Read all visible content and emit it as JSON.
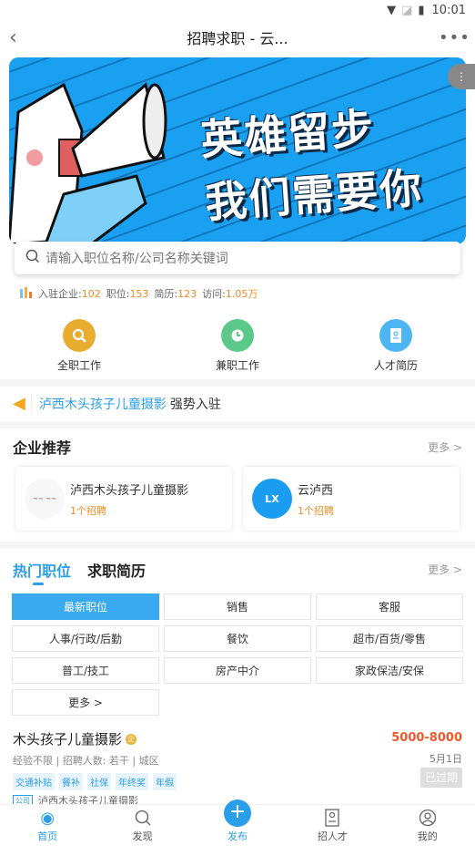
{
  "status_bar": {
    "time": "10:01"
  },
  "nav": {
    "title": "招聘求职 - 云...",
    "back_icon": "‹",
    "more_icon": "•••"
  },
  "banner": {
    "line1": "英雄留步",
    "line2": "我们需要你"
  },
  "search": {
    "placeholder": "请输入职位名称/公司名称关键词"
  },
  "stats": [
    {
      "label": "入驻企业:",
      "value": "102"
    },
    {
      "label": "职位:",
      "value": "153"
    },
    {
      "label": "简历:",
      "value": "123"
    },
    {
      "label": "访问:",
      "value": "1.05万"
    }
  ],
  "quick_entries": [
    {
      "label": "全职工作",
      "icon": "search-icon",
      "color": "#e8ad2e"
    },
    {
      "label": "兼职工作",
      "icon": "clock-icon",
      "color": "#5cc98a"
    },
    {
      "label": "人才简历",
      "icon": "resume-icon",
      "color": "#4cb6f5"
    }
  ],
  "notice": {
    "company": "泸西木头孩子儿童摄影",
    "text": "强势入驻"
  },
  "companies": {
    "title": "企业推荐",
    "more": "更多 >",
    "items": [
      {
        "name": "泸西木头孩子儿童摄影",
        "count": "1个招聘"
      },
      {
        "name": "云泸西",
        "count": "1个招聘",
        "logo_text": "LX"
      }
    ]
  },
  "jobs_section": {
    "tabs": [
      "热门职位",
      "求职简历"
    ],
    "active_tab": 0,
    "more": "更多 >",
    "categories": [
      "最新职位",
      "销售",
      "客服",
      "人事/行政/后勤",
      "餐饮",
      "超市/百货/零售",
      "普工/技工",
      "房产中介",
      "家政保洁/安保",
      "更多 >"
    ],
    "active_category": 0
  },
  "job": {
    "title": "木头孩子儿童摄影",
    "badge": "企",
    "meta": "经验不限 | 招聘人数: 若干 | 城区",
    "tags": [
      "交通补贴",
      "餐补",
      "社保",
      "年终奖",
      "年假"
    ],
    "company_badge": "公司",
    "company": "泸西木头孩子儿童摄影",
    "salary": "5000-8000",
    "date": "5月1日",
    "status": "已过期"
  },
  "tabbar": [
    {
      "label": "首页",
      "active": true
    },
    {
      "label": "发现"
    },
    {
      "label": "发布"
    },
    {
      "label": "招人才"
    },
    {
      "label": "我的"
    }
  ]
}
